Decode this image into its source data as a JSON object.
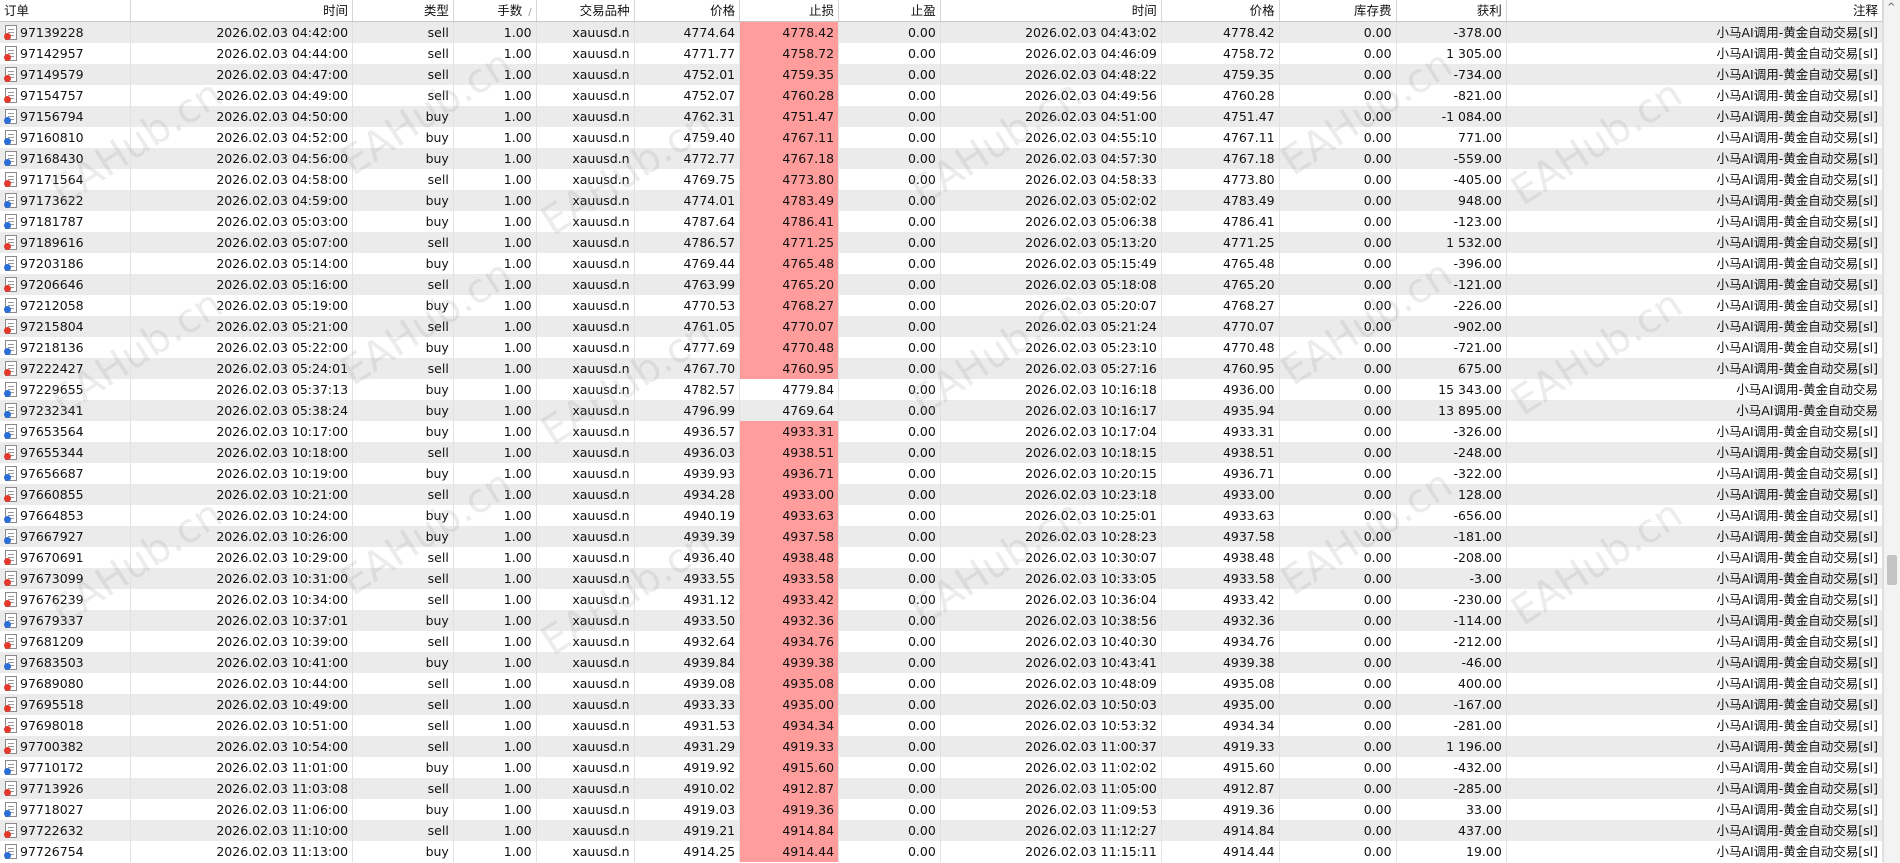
{
  "columns": [
    "订单",
    "时间",
    "类型",
    "手数",
    "交易品种",
    "价格",
    "止损",
    "止盈",
    "时间",
    "价格",
    "库存费",
    "获利",
    "注释"
  ],
  "header_icons": {
    "sort": "sort-indicator-icon",
    "scroll_up": "scroll-up-arrow-icon"
  },
  "watermark_text": "EAHub.cn",
  "colors": {
    "sl_highlight": "#ff9c9c",
    "sell_icon": "#e23b2e",
    "buy_icon": "#2a6fd6",
    "alt_row": "#ebebeb"
  },
  "rows": [
    {
      "order": "97139228",
      "open_time": "2026.02.03 04:42:00",
      "type": "sell",
      "lots": "1.00",
      "symbol": "xauusd.n",
      "open_price": "4774.64",
      "sl": "4778.42",
      "sl_hit": true,
      "tp": "0.00",
      "close_time": "2026.02.03 04:43:02",
      "close_price": "4778.42",
      "swap": "0.00",
      "profit": "-378.00",
      "comment": "小马AI调用-黄金自动交易[sl]"
    },
    {
      "order": "97142957",
      "open_time": "2026.02.03 04:44:00",
      "type": "sell",
      "lots": "1.00",
      "symbol": "xauusd.n",
      "open_price": "4771.77",
      "sl": "4758.72",
      "sl_hit": true,
      "tp": "0.00",
      "close_time": "2026.02.03 04:46:09",
      "close_price": "4758.72",
      "swap": "0.00",
      "profit": "1 305.00",
      "comment": "小马AI调用-黄金自动交易[sl]"
    },
    {
      "order": "97149579",
      "open_time": "2026.02.03 04:47:00",
      "type": "sell",
      "lots": "1.00",
      "symbol": "xauusd.n",
      "open_price": "4752.01",
      "sl": "4759.35",
      "sl_hit": true,
      "tp": "0.00",
      "close_time": "2026.02.03 04:48:22",
      "close_price": "4759.35",
      "swap": "0.00",
      "profit": "-734.00",
      "comment": "小马AI调用-黄金自动交易[sl]"
    },
    {
      "order": "97154757",
      "open_time": "2026.02.03 04:49:00",
      "type": "sell",
      "lots": "1.00",
      "symbol": "xauusd.n",
      "open_price": "4752.07",
      "sl": "4760.28",
      "sl_hit": true,
      "tp": "0.00",
      "close_time": "2026.02.03 04:49:56",
      "close_price": "4760.28",
      "swap": "0.00",
      "profit": "-821.00",
      "comment": "小马AI调用-黄金自动交易[sl]"
    },
    {
      "order": "97156794",
      "open_time": "2026.02.03 04:50:00",
      "type": "buy",
      "lots": "1.00",
      "symbol": "xauusd.n",
      "open_price": "4762.31",
      "sl": "4751.47",
      "sl_hit": true,
      "tp": "0.00",
      "close_time": "2026.02.03 04:51:00",
      "close_price": "4751.47",
      "swap": "0.00",
      "profit": "-1 084.00",
      "comment": "小马AI调用-黄金自动交易[sl]"
    },
    {
      "order": "97160810",
      "open_time": "2026.02.03 04:52:00",
      "type": "buy",
      "lots": "1.00",
      "symbol": "xauusd.n",
      "open_price": "4759.40",
      "sl": "4767.11",
      "sl_hit": true,
      "tp": "0.00",
      "close_time": "2026.02.03 04:55:10",
      "close_price": "4767.11",
      "swap": "0.00",
      "profit": "771.00",
      "comment": "小马AI调用-黄金自动交易[sl]"
    },
    {
      "order": "97168430",
      "open_time": "2026.02.03 04:56:00",
      "type": "buy",
      "lots": "1.00",
      "symbol": "xauusd.n",
      "open_price": "4772.77",
      "sl": "4767.18",
      "sl_hit": true,
      "tp": "0.00",
      "close_time": "2026.02.03 04:57:30",
      "close_price": "4767.18",
      "swap": "0.00",
      "profit": "-559.00",
      "comment": "小马AI调用-黄金自动交易[sl]"
    },
    {
      "order": "97171564",
      "open_time": "2026.02.03 04:58:00",
      "type": "sell",
      "lots": "1.00",
      "symbol": "xauusd.n",
      "open_price": "4769.75",
      "sl": "4773.80",
      "sl_hit": true,
      "tp": "0.00",
      "close_time": "2026.02.03 04:58:33",
      "close_price": "4773.80",
      "swap": "0.00",
      "profit": "-405.00",
      "comment": "小马AI调用-黄金自动交易[sl]"
    },
    {
      "order": "97173622",
      "open_time": "2026.02.03 04:59:00",
      "type": "buy",
      "lots": "1.00",
      "symbol": "xauusd.n",
      "open_price": "4774.01",
      "sl": "4783.49",
      "sl_hit": true,
      "tp": "0.00",
      "close_time": "2026.02.03 05:02:02",
      "close_price": "4783.49",
      "swap": "0.00",
      "profit": "948.00",
      "comment": "小马AI调用-黄金自动交易[sl]"
    },
    {
      "order": "97181787",
      "open_time": "2026.02.03 05:03:00",
      "type": "buy",
      "lots": "1.00",
      "symbol": "xauusd.n",
      "open_price": "4787.64",
      "sl": "4786.41",
      "sl_hit": true,
      "tp": "0.00",
      "close_time": "2026.02.03 05:06:38",
      "close_price": "4786.41",
      "swap": "0.00",
      "profit": "-123.00",
      "comment": "小马AI调用-黄金自动交易[sl]"
    },
    {
      "order": "97189616",
      "open_time": "2026.02.03 05:07:00",
      "type": "sell",
      "lots": "1.00",
      "symbol": "xauusd.n",
      "open_price": "4786.57",
      "sl": "4771.25",
      "sl_hit": true,
      "tp": "0.00",
      "close_time": "2026.02.03 05:13:20",
      "close_price": "4771.25",
      "swap": "0.00",
      "profit": "1 532.00",
      "comment": "小马AI调用-黄金自动交易[sl]"
    },
    {
      "order": "97203186",
      "open_time": "2026.02.03 05:14:00",
      "type": "buy",
      "lots": "1.00",
      "symbol": "xauusd.n",
      "open_price": "4769.44",
      "sl": "4765.48",
      "sl_hit": true,
      "tp": "0.00",
      "close_time": "2026.02.03 05:15:49",
      "close_price": "4765.48",
      "swap": "0.00",
      "profit": "-396.00",
      "comment": "小马AI调用-黄金自动交易[sl]"
    },
    {
      "order": "97206646",
      "open_time": "2026.02.03 05:16:00",
      "type": "sell",
      "lots": "1.00",
      "symbol": "xauusd.n",
      "open_price": "4763.99",
      "sl": "4765.20",
      "sl_hit": true,
      "tp": "0.00",
      "close_time": "2026.02.03 05:18:08",
      "close_price": "4765.20",
      "swap": "0.00",
      "profit": "-121.00",
      "comment": "小马AI调用-黄金自动交易[sl]"
    },
    {
      "order": "97212058",
      "open_time": "2026.02.03 05:19:00",
      "type": "buy",
      "lots": "1.00",
      "symbol": "xauusd.n",
      "open_price": "4770.53",
      "sl": "4768.27",
      "sl_hit": true,
      "tp": "0.00",
      "close_time": "2026.02.03 05:20:07",
      "close_price": "4768.27",
      "swap": "0.00",
      "profit": "-226.00",
      "comment": "小马AI调用-黄金自动交易[sl]"
    },
    {
      "order": "97215804",
      "open_time": "2026.02.03 05:21:00",
      "type": "sell",
      "lots": "1.00",
      "symbol": "xauusd.n",
      "open_price": "4761.05",
      "sl": "4770.07",
      "sl_hit": true,
      "tp": "0.00",
      "close_time": "2026.02.03 05:21:24",
      "close_price": "4770.07",
      "swap": "0.00",
      "profit": "-902.00",
      "comment": "小马AI调用-黄金自动交易[sl]"
    },
    {
      "order": "97218136",
      "open_time": "2026.02.03 05:22:00",
      "type": "buy",
      "lots": "1.00",
      "symbol": "xauusd.n",
      "open_price": "4777.69",
      "sl": "4770.48",
      "sl_hit": true,
      "tp": "0.00",
      "close_time": "2026.02.03 05:23:10",
      "close_price": "4770.48",
      "swap": "0.00",
      "profit": "-721.00",
      "comment": "小马AI调用-黄金自动交易[sl]"
    },
    {
      "order": "97222427",
      "open_time": "2026.02.03 05:24:01",
      "type": "sell",
      "lots": "1.00",
      "symbol": "xauusd.n",
      "open_price": "4767.70",
      "sl": "4760.95",
      "sl_hit": true,
      "tp": "0.00",
      "close_time": "2026.02.03 05:27:16",
      "close_price": "4760.95",
      "swap": "0.00",
      "profit": "675.00",
      "comment": "小马AI调用-黄金自动交易[sl]"
    },
    {
      "order": "97229655",
      "open_time": "2026.02.03 05:37:13",
      "type": "buy",
      "lots": "1.00",
      "symbol": "xauusd.n",
      "open_price": "4782.57",
      "sl": "4779.84",
      "sl_hit": false,
      "tp": "0.00",
      "close_time": "2026.02.03 10:16:18",
      "close_price": "4936.00",
      "swap": "0.00",
      "profit": "15 343.00",
      "comment": "小马AI调用-黄金自动交易"
    },
    {
      "order": "97232341",
      "open_time": "2026.02.03 05:38:24",
      "type": "buy",
      "lots": "1.00",
      "symbol": "xauusd.n",
      "open_price": "4796.99",
      "sl": "4769.64",
      "sl_hit": false,
      "tp": "0.00",
      "close_time": "2026.02.03 10:16:17",
      "close_price": "4935.94",
      "swap": "0.00",
      "profit": "13 895.00",
      "comment": "小马AI调用-黄金自动交易"
    },
    {
      "order": "97653564",
      "open_time": "2026.02.03 10:17:00",
      "type": "buy",
      "lots": "1.00",
      "symbol": "xauusd.n",
      "open_price": "4936.57",
      "sl": "4933.31",
      "sl_hit": true,
      "tp": "0.00",
      "close_time": "2026.02.03 10:17:04",
      "close_price": "4933.31",
      "swap": "0.00",
      "profit": "-326.00",
      "comment": "小马AI调用-黄金自动交易[sl]"
    },
    {
      "order": "97655344",
      "open_time": "2026.02.03 10:18:00",
      "type": "sell",
      "lots": "1.00",
      "symbol": "xauusd.n",
      "open_price": "4936.03",
      "sl": "4938.51",
      "sl_hit": true,
      "tp": "0.00",
      "close_time": "2026.02.03 10:18:15",
      "close_price": "4938.51",
      "swap": "0.00",
      "profit": "-248.00",
      "comment": "小马AI调用-黄金自动交易[sl]"
    },
    {
      "order": "97656687",
      "open_time": "2026.02.03 10:19:00",
      "type": "buy",
      "lots": "1.00",
      "symbol": "xauusd.n",
      "open_price": "4939.93",
      "sl": "4936.71",
      "sl_hit": true,
      "tp": "0.00",
      "close_time": "2026.02.03 10:20:15",
      "close_price": "4936.71",
      "swap": "0.00",
      "profit": "-322.00",
      "comment": "小马AI调用-黄金自动交易[sl]"
    },
    {
      "order": "97660855",
      "open_time": "2026.02.03 10:21:00",
      "type": "sell",
      "lots": "1.00",
      "symbol": "xauusd.n",
      "open_price": "4934.28",
      "sl": "4933.00",
      "sl_hit": true,
      "tp": "0.00",
      "close_time": "2026.02.03 10:23:18",
      "close_price": "4933.00",
      "swap": "0.00",
      "profit": "128.00",
      "comment": "小马AI调用-黄金自动交易[sl]"
    },
    {
      "order": "97664853",
      "open_time": "2026.02.03 10:24:00",
      "type": "buy",
      "lots": "1.00",
      "symbol": "xauusd.n",
      "open_price": "4940.19",
      "sl": "4933.63",
      "sl_hit": true,
      "tp": "0.00",
      "close_time": "2026.02.03 10:25:01",
      "close_price": "4933.63",
      "swap": "0.00",
      "profit": "-656.00",
      "comment": "小马AI调用-黄金自动交易[sl]"
    },
    {
      "order": "97667927",
      "open_time": "2026.02.03 10:26:00",
      "type": "buy",
      "lots": "1.00",
      "symbol": "xauusd.n",
      "open_price": "4939.39",
      "sl": "4937.58",
      "sl_hit": true,
      "tp": "0.00",
      "close_time": "2026.02.03 10:28:23",
      "close_price": "4937.58",
      "swap": "0.00",
      "profit": "-181.00",
      "comment": "小马AI调用-黄金自动交易[sl]"
    },
    {
      "order": "97670691",
      "open_time": "2026.02.03 10:29:00",
      "type": "sell",
      "lots": "1.00",
      "symbol": "xauusd.n",
      "open_price": "4936.40",
      "sl": "4938.48",
      "sl_hit": true,
      "tp": "0.00",
      "close_time": "2026.02.03 10:30:07",
      "close_price": "4938.48",
      "swap": "0.00",
      "profit": "-208.00",
      "comment": "小马AI调用-黄金自动交易[sl]"
    },
    {
      "order": "97673099",
      "open_time": "2026.02.03 10:31:00",
      "type": "sell",
      "lots": "1.00",
      "symbol": "xauusd.n",
      "open_price": "4933.55",
      "sl": "4933.58",
      "sl_hit": true,
      "tp": "0.00",
      "close_time": "2026.02.03 10:33:05",
      "close_price": "4933.58",
      "swap": "0.00",
      "profit": "-3.00",
      "comment": "小马AI调用-黄金自动交易[sl]"
    },
    {
      "order": "97676239",
      "open_time": "2026.02.03 10:34:00",
      "type": "sell",
      "lots": "1.00",
      "symbol": "xauusd.n",
      "open_price": "4931.12",
      "sl": "4933.42",
      "sl_hit": true,
      "tp": "0.00",
      "close_time": "2026.02.03 10:36:04",
      "close_price": "4933.42",
      "swap": "0.00",
      "profit": "-230.00",
      "comment": "小马AI调用-黄金自动交易[sl]"
    },
    {
      "order": "97679337",
      "open_time": "2026.02.03 10:37:01",
      "type": "buy",
      "lots": "1.00",
      "symbol": "xauusd.n",
      "open_price": "4933.50",
      "sl": "4932.36",
      "sl_hit": true,
      "tp": "0.00",
      "close_time": "2026.02.03 10:38:56",
      "close_price": "4932.36",
      "swap": "0.00",
      "profit": "-114.00",
      "comment": "小马AI调用-黄金自动交易[sl]"
    },
    {
      "order": "97681209",
      "open_time": "2026.02.03 10:39:00",
      "type": "sell",
      "lots": "1.00",
      "symbol": "xauusd.n",
      "open_price": "4932.64",
      "sl": "4934.76",
      "sl_hit": true,
      "tp": "0.00",
      "close_time": "2026.02.03 10:40:30",
      "close_price": "4934.76",
      "swap": "0.00",
      "profit": "-212.00",
      "comment": "小马AI调用-黄金自动交易[sl]"
    },
    {
      "order": "97683503",
      "open_time": "2026.02.03 10:41:00",
      "type": "buy",
      "lots": "1.00",
      "symbol": "xauusd.n",
      "open_price": "4939.84",
      "sl": "4939.38",
      "sl_hit": true,
      "tp": "0.00",
      "close_time": "2026.02.03 10:43:41",
      "close_price": "4939.38",
      "swap": "0.00",
      "profit": "-46.00",
      "comment": "小马AI调用-黄金自动交易[sl]"
    },
    {
      "order": "97689080",
      "open_time": "2026.02.03 10:44:00",
      "type": "sell",
      "lots": "1.00",
      "symbol": "xauusd.n",
      "open_price": "4939.08",
      "sl": "4935.08",
      "sl_hit": true,
      "tp": "0.00",
      "close_time": "2026.02.03 10:48:09",
      "close_price": "4935.08",
      "swap": "0.00",
      "profit": "400.00",
      "comment": "小马AI调用-黄金自动交易[sl]"
    },
    {
      "order": "97695518",
      "open_time": "2026.02.03 10:49:00",
      "type": "sell",
      "lots": "1.00",
      "symbol": "xauusd.n",
      "open_price": "4933.33",
      "sl": "4935.00",
      "sl_hit": true,
      "tp": "0.00",
      "close_time": "2026.02.03 10:50:03",
      "close_price": "4935.00",
      "swap": "0.00",
      "profit": "-167.00",
      "comment": "小马AI调用-黄金自动交易[sl]"
    },
    {
      "order": "97698018",
      "open_time": "2026.02.03 10:51:00",
      "type": "sell",
      "lots": "1.00",
      "symbol": "xauusd.n",
      "open_price": "4931.53",
      "sl": "4934.34",
      "sl_hit": true,
      "tp": "0.00",
      "close_time": "2026.02.03 10:53:32",
      "close_price": "4934.34",
      "swap": "0.00",
      "profit": "-281.00",
      "comment": "小马AI调用-黄金自动交易[sl]"
    },
    {
      "order": "97700382",
      "open_time": "2026.02.03 10:54:00",
      "type": "sell",
      "lots": "1.00",
      "symbol": "xauusd.n",
      "open_price": "4931.29",
      "sl": "4919.33",
      "sl_hit": true,
      "tp": "0.00",
      "close_time": "2026.02.03 11:00:37",
      "close_price": "4919.33",
      "swap": "0.00",
      "profit": "1 196.00",
      "comment": "小马AI调用-黄金自动交易[sl]"
    },
    {
      "order": "97710172",
      "open_time": "2026.02.03 11:01:00",
      "type": "buy",
      "lots": "1.00",
      "symbol": "xauusd.n",
      "open_price": "4919.92",
      "sl": "4915.60",
      "sl_hit": true,
      "tp": "0.00",
      "close_time": "2026.02.03 11:02:02",
      "close_price": "4915.60",
      "swap": "0.00",
      "profit": "-432.00",
      "comment": "小马AI调用-黄金自动交易[sl]"
    },
    {
      "order": "97713926",
      "open_time": "2026.02.03 11:03:08",
      "type": "sell",
      "lots": "1.00",
      "symbol": "xauusd.n",
      "open_price": "4910.02",
      "sl": "4912.87",
      "sl_hit": true,
      "tp": "0.00",
      "close_time": "2026.02.03 11:05:00",
      "close_price": "4912.87",
      "swap": "0.00",
      "profit": "-285.00",
      "comment": "小马AI调用-黄金自动交易[sl]"
    },
    {
      "order": "97718027",
      "open_time": "2026.02.03 11:06:00",
      "type": "buy",
      "lots": "1.00",
      "symbol": "xauusd.n",
      "open_price": "4919.03",
      "sl": "4919.36",
      "sl_hit": true,
      "tp": "0.00",
      "close_time": "2026.02.03 11:09:53",
      "close_price": "4919.36",
      "swap": "0.00",
      "profit": "33.00",
      "comment": "小马AI调用-黄金自动交易[sl]"
    },
    {
      "order": "97722632",
      "open_time": "2026.02.03 11:10:00",
      "type": "sell",
      "lots": "1.00",
      "symbol": "xauusd.n",
      "open_price": "4919.21",
      "sl": "4914.84",
      "sl_hit": true,
      "tp": "0.00",
      "close_time": "2026.02.03 11:12:27",
      "close_price": "4914.84",
      "swap": "0.00",
      "profit": "437.00",
      "comment": "小马AI调用-黄金自动交易[sl]"
    },
    {
      "order": "97726754",
      "open_time": "2026.02.03 11:13:00",
      "type": "buy",
      "lots": "1.00",
      "symbol": "xauusd.n",
      "open_price": "4914.25",
      "sl": "4914.44",
      "sl_hit": true,
      "tp": "0.00",
      "close_time": "2026.02.03 11:15:11",
      "close_price": "4914.44",
      "swap": "0.00",
      "profit": "19.00",
      "comment": "小马AI调用-黄金自动交易[sl]"
    }
  ]
}
